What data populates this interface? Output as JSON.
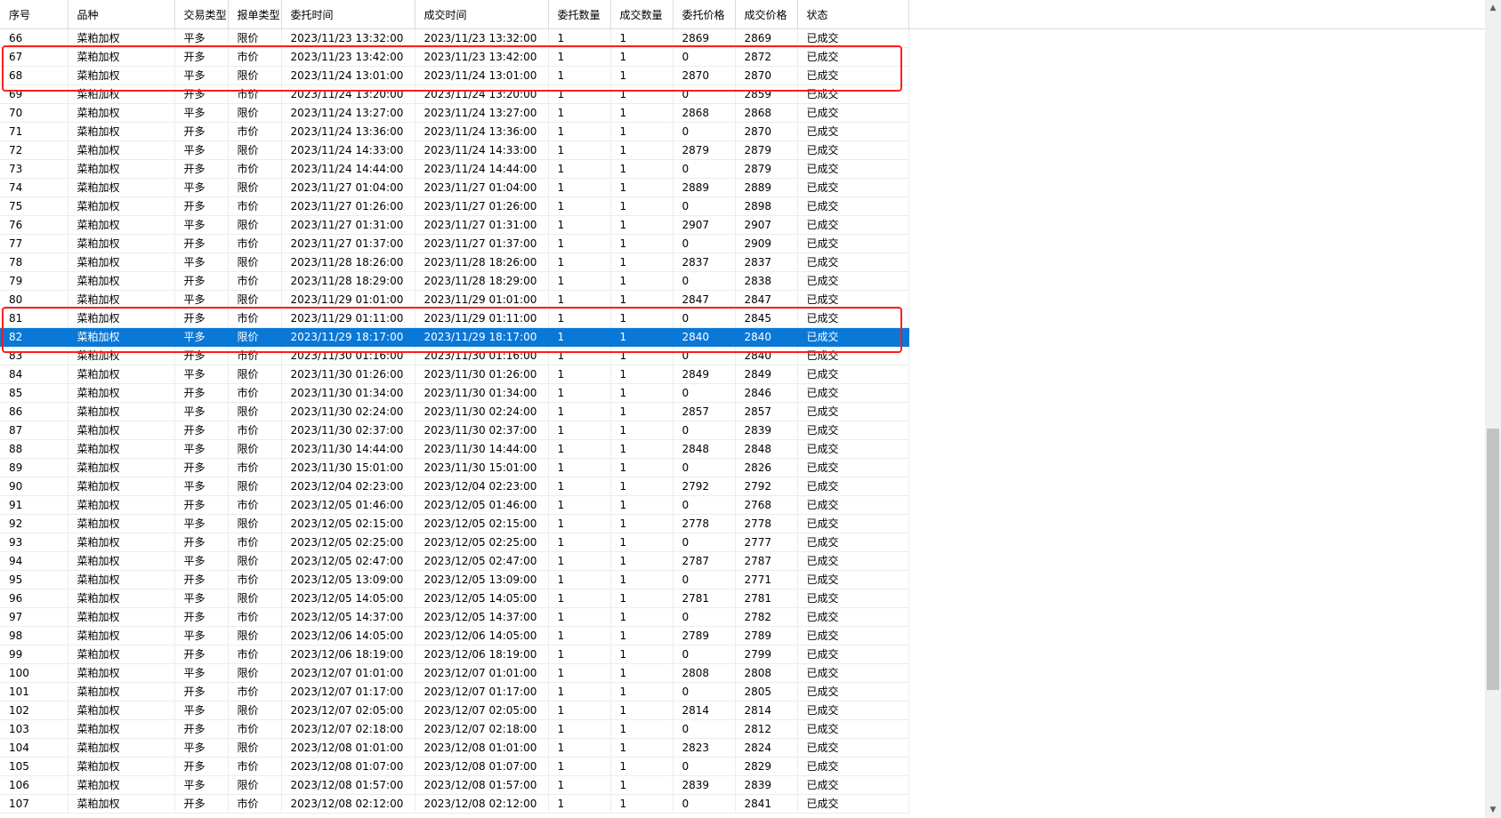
{
  "table": {
    "columns": [
      "序号",
      "品种",
      "交易类型",
      "报单类型",
      "委托时间",
      "成交时间",
      "委托数量",
      "成交数量",
      "委托价格",
      "成交价格",
      "状态"
    ],
    "selected_row": "82",
    "rows": [
      [
        "66",
        "菜粕加权",
        "平多",
        "限价",
        "2023/11/23 13:32:00",
        "2023/11/23 13:32:00",
        "1",
        "1",
        "2869",
        "2869",
        "已成交"
      ],
      [
        "67",
        "菜粕加权",
        "开多",
        "市价",
        "2023/11/23 13:42:00",
        "2023/11/23 13:42:00",
        "1",
        "1",
        "0",
        "2872",
        "已成交"
      ],
      [
        "68",
        "菜粕加权",
        "平多",
        "限价",
        "2023/11/24 13:01:00",
        "2023/11/24 13:01:00",
        "1",
        "1",
        "2870",
        "2870",
        "已成交"
      ],
      [
        "69",
        "菜粕加权",
        "开多",
        "市价",
        "2023/11/24 13:20:00",
        "2023/11/24 13:20:00",
        "1",
        "1",
        "0",
        "2859",
        "已成交"
      ],
      [
        "70",
        "菜粕加权",
        "平多",
        "限价",
        "2023/11/24 13:27:00",
        "2023/11/24 13:27:00",
        "1",
        "1",
        "2868",
        "2868",
        "已成交"
      ],
      [
        "71",
        "菜粕加权",
        "开多",
        "市价",
        "2023/11/24 13:36:00",
        "2023/11/24 13:36:00",
        "1",
        "1",
        "0",
        "2870",
        "已成交"
      ],
      [
        "72",
        "菜粕加权",
        "平多",
        "限价",
        "2023/11/24 14:33:00",
        "2023/11/24 14:33:00",
        "1",
        "1",
        "2879",
        "2879",
        "已成交"
      ],
      [
        "73",
        "菜粕加权",
        "开多",
        "市价",
        "2023/11/24 14:44:00",
        "2023/11/24 14:44:00",
        "1",
        "1",
        "0",
        "2879",
        "已成交"
      ],
      [
        "74",
        "菜粕加权",
        "平多",
        "限价",
        "2023/11/27 01:04:00",
        "2023/11/27 01:04:00",
        "1",
        "1",
        "2889",
        "2889",
        "已成交"
      ],
      [
        "75",
        "菜粕加权",
        "开多",
        "市价",
        "2023/11/27 01:26:00",
        "2023/11/27 01:26:00",
        "1",
        "1",
        "0",
        "2898",
        "已成交"
      ],
      [
        "76",
        "菜粕加权",
        "平多",
        "限价",
        "2023/11/27 01:31:00",
        "2023/11/27 01:31:00",
        "1",
        "1",
        "2907",
        "2907",
        "已成交"
      ],
      [
        "77",
        "菜粕加权",
        "开多",
        "市价",
        "2023/11/27 01:37:00",
        "2023/11/27 01:37:00",
        "1",
        "1",
        "0",
        "2909",
        "已成交"
      ],
      [
        "78",
        "菜粕加权",
        "平多",
        "限价",
        "2023/11/28 18:26:00",
        "2023/11/28 18:26:00",
        "1",
        "1",
        "2837",
        "2837",
        "已成交"
      ],
      [
        "79",
        "菜粕加权",
        "开多",
        "市价",
        "2023/11/28 18:29:00",
        "2023/11/28 18:29:00",
        "1",
        "1",
        "0",
        "2838",
        "已成交"
      ],
      [
        "80",
        "菜粕加权",
        "平多",
        "限价",
        "2023/11/29 01:01:00",
        "2023/11/29 01:01:00",
        "1",
        "1",
        "2847",
        "2847",
        "已成交"
      ],
      [
        "81",
        "菜粕加权",
        "开多",
        "市价",
        "2023/11/29 01:11:00",
        "2023/11/29 01:11:00",
        "1",
        "1",
        "0",
        "2845",
        "已成交"
      ],
      [
        "82",
        "菜粕加权",
        "平多",
        "限价",
        "2023/11/29 18:17:00",
        "2023/11/29 18:17:00",
        "1",
        "1",
        "2840",
        "2840",
        "已成交"
      ],
      [
        "83",
        "菜粕加权",
        "开多",
        "市价",
        "2023/11/30 01:16:00",
        "2023/11/30 01:16:00",
        "1",
        "1",
        "0",
        "2840",
        "已成交"
      ],
      [
        "84",
        "菜粕加权",
        "平多",
        "限价",
        "2023/11/30 01:26:00",
        "2023/11/30 01:26:00",
        "1",
        "1",
        "2849",
        "2849",
        "已成交"
      ],
      [
        "85",
        "菜粕加权",
        "开多",
        "市价",
        "2023/11/30 01:34:00",
        "2023/11/30 01:34:00",
        "1",
        "1",
        "0",
        "2846",
        "已成交"
      ],
      [
        "86",
        "菜粕加权",
        "平多",
        "限价",
        "2023/11/30 02:24:00",
        "2023/11/30 02:24:00",
        "1",
        "1",
        "2857",
        "2857",
        "已成交"
      ],
      [
        "87",
        "菜粕加权",
        "开多",
        "市价",
        "2023/11/30 02:37:00",
        "2023/11/30 02:37:00",
        "1",
        "1",
        "0",
        "2839",
        "已成交"
      ],
      [
        "88",
        "菜粕加权",
        "平多",
        "限价",
        "2023/11/30 14:44:00",
        "2023/11/30 14:44:00",
        "1",
        "1",
        "2848",
        "2848",
        "已成交"
      ],
      [
        "89",
        "菜粕加权",
        "开多",
        "市价",
        "2023/11/30 15:01:00",
        "2023/11/30 15:01:00",
        "1",
        "1",
        "0",
        "2826",
        "已成交"
      ],
      [
        "90",
        "菜粕加权",
        "平多",
        "限价",
        "2023/12/04 02:23:00",
        "2023/12/04 02:23:00",
        "1",
        "1",
        "2792",
        "2792",
        "已成交"
      ],
      [
        "91",
        "菜粕加权",
        "开多",
        "市价",
        "2023/12/05 01:46:00",
        "2023/12/05 01:46:00",
        "1",
        "1",
        "0",
        "2768",
        "已成交"
      ],
      [
        "92",
        "菜粕加权",
        "平多",
        "限价",
        "2023/12/05 02:15:00",
        "2023/12/05 02:15:00",
        "1",
        "1",
        "2778",
        "2778",
        "已成交"
      ],
      [
        "93",
        "菜粕加权",
        "开多",
        "市价",
        "2023/12/05 02:25:00",
        "2023/12/05 02:25:00",
        "1",
        "1",
        "0",
        "2777",
        "已成交"
      ],
      [
        "94",
        "菜粕加权",
        "平多",
        "限价",
        "2023/12/05 02:47:00",
        "2023/12/05 02:47:00",
        "1",
        "1",
        "2787",
        "2787",
        "已成交"
      ],
      [
        "95",
        "菜粕加权",
        "开多",
        "市价",
        "2023/12/05 13:09:00",
        "2023/12/05 13:09:00",
        "1",
        "1",
        "0",
        "2771",
        "已成交"
      ],
      [
        "96",
        "菜粕加权",
        "平多",
        "限价",
        "2023/12/05 14:05:00",
        "2023/12/05 14:05:00",
        "1",
        "1",
        "2781",
        "2781",
        "已成交"
      ],
      [
        "97",
        "菜粕加权",
        "开多",
        "市价",
        "2023/12/05 14:37:00",
        "2023/12/05 14:37:00",
        "1",
        "1",
        "0",
        "2782",
        "已成交"
      ],
      [
        "98",
        "菜粕加权",
        "平多",
        "限价",
        "2023/12/06 14:05:00",
        "2023/12/06 14:05:00",
        "1",
        "1",
        "2789",
        "2789",
        "已成交"
      ],
      [
        "99",
        "菜粕加权",
        "开多",
        "市价",
        "2023/12/06 18:19:00",
        "2023/12/06 18:19:00",
        "1",
        "1",
        "0",
        "2799",
        "已成交"
      ],
      [
        "100",
        "菜粕加权",
        "平多",
        "限价",
        "2023/12/07 01:01:00",
        "2023/12/07 01:01:00",
        "1",
        "1",
        "2808",
        "2808",
        "已成交"
      ],
      [
        "101",
        "菜粕加权",
        "开多",
        "市价",
        "2023/12/07 01:17:00",
        "2023/12/07 01:17:00",
        "1",
        "1",
        "0",
        "2805",
        "已成交"
      ],
      [
        "102",
        "菜粕加权",
        "平多",
        "限价",
        "2023/12/07 02:05:00",
        "2023/12/07 02:05:00",
        "1",
        "1",
        "2814",
        "2814",
        "已成交"
      ],
      [
        "103",
        "菜粕加权",
        "开多",
        "市价",
        "2023/12/07 02:18:00",
        "2023/12/07 02:18:00",
        "1",
        "1",
        "0",
        "2812",
        "已成交"
      ],
      [
        "104",
        "菜粕加权",
        "平多",
        "限价",
        "2023/12/08 01:01:00",
        "2023/12/08 01:01:00",
        "1",
        "1",
        "2823",
        "2824",
        "已成交"
      ],
      [
        "105",
        "菜粕加权",
        "开多",
        "市价",
        "2023/12/08 01:07:00",
        "2023/12/08 01:07:00",
        "1",
        "1",
        "0",
        "2829",
        "已成交"
      ],
      [
        "106",
        "菜粕加权",
        "平多",
        "限价",
        "2023/12/08 01:57:00",
        "2023/12/08 01:57:00",
        "1",
        "1",
        "2839",
        "2839",
        "已成交"
      ],
      [
        "107",
        "菜粕加权",
        "开多",
        "市价",
        "2023/12/08 02:12:00",
        "2023/12/08 02:12:00",
        "1",
        "1",
        "0",
        "2841",
        "已成交"
      ]
    ]
  },
  "annotations": {
    "highlight_color": "#ff1d1d",
    "highlighted_rows": [
      [
        "67",
        "68"
      ],
      [
        "81",
        "82"
      ]
    ]
  },
  "colors": {
    "selection": "#0a78d7",
    "grid": "#ececec"
  },
  "icons": {
    "scroll_up": "chevron-up-icon",
    "scroll_down": "chevron-down-icon"
  }
}
